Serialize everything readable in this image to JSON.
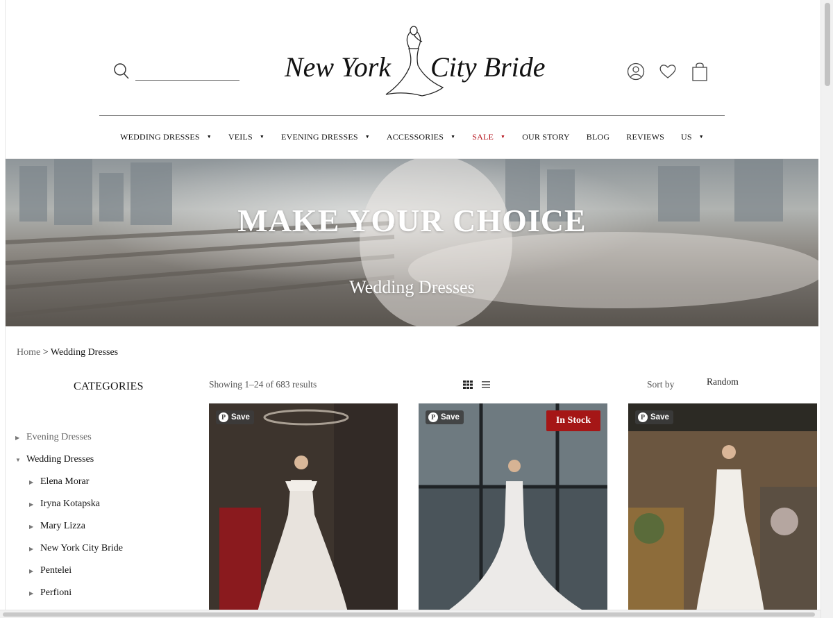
{
  "header": {
    "search_placeholder": "",
    "logo_text": "New York City Bride"
  },
  "nav": [
    {
      "label": "WEDDING DRESSES",
      "caret": true
    },
    {
      "label": "VEILS",
      "caret": true
    },
    {
      "label": "EVENING DRESSES",
      "caret": true
    },
    {
      "label": "ACCESSORIES",
      "caret": true
    },
    {
      "label": "SALE",
      "caret": true
    },
    {
      "label": "OUR STORY",
      "caret": false
    },
    {
      "label": "BLOG",
      "caret": false
    },
    {
      "label": "REVIEWS",
      "caret": false
    },
    {
      "label": "US",
      "caret": true
    }
  ],
  "hero": {
    "title": "MAKE YOUR CHOICE",
    "subtitle": "Wedding Dresses"
  },
  "breadcrumb": {
    "home": "Home",
    "separator": " > ",
    "current": "Wedding Dresses"
  },
  "sidebar": {
    "title": "CATEGORIES",
    "items": [
      {
        "label": "Evening Dresses",
        "level": 0,
        "expanded": false,
        "muted": true
      },
      {
        "label": "Wedding Dresses",
        "level": 0,
        "expanded": true,
        "muted": false
      },
      {
        "label": "Elena Morar",
        "level": 1,
        "expanded": false,
        "muted": false
      },
      {
        "label": "Iryna Kotapska",
        "level": 1,
        "expanded": false,
        "muted": false
      },
      {
        "label": "Mary Lizza",
        "level": 1,
        "expanded": false,
        "muted": false
      },
      {
        "label": "New York City Bride",
        "level": 1,
        "expanded": false,
        "muted": false
      },
      {
        "label": "Pentelei",
        "level": 1,
        "expanded": false,
        "muted": false
      },
      {
        "label": "Perfioni",
        "level": 1,
        "expanded": false,
        "muted": false
      }
    ]
  },
  "toolbar": {
    "showing": "Showing 1–24 of 683 results",
    "sort_label": "Sort by",
    "sort_value": "Random"
  },
  "products": [
    {
      "save_label": "Save",
      "badge": ""
    },
    {
      "save_label": "Save",
      "badge": "In Stock"
    },
    {
      "save_label": "Save",
      "badge": ""
    }
  ],
  "colors": {
    "sale": "#b5121b",
    "badge": "#a51616"
  }
}
